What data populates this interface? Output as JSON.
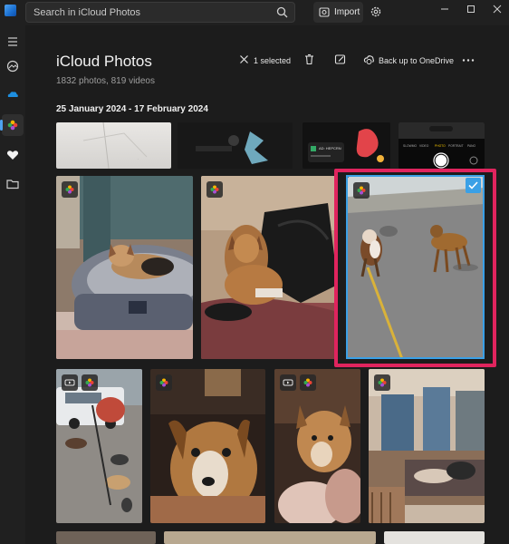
{
  "titlebar": {
    "search_placeholder": "Search in iCloud Photos",
    "import_label": "Import",
    "icons": [
      "app-logo-icon",
      "search-icon",
      "import-icon",
      "gear-icon",
      "minimize-icon",
      "maximize-icon",
      "close-icon"
    ]
  },
  "sidebar": {
    "items": [
      {
        "name": "menu",
        "icon": "hamburger-icon"
      },
      {
        "name": "gallery",
        "icon": "photos-icon"
      },
      {
        "name": "onedrive",
        "icon": "cloud-icon"
      },
      {
        "name": "icloud-photos",
        "icon": "icloud-photos-icon",
        "selected": true
      },
      {
        "name": "favorites",
        "icon": "heart-icon"
      },
      {
        "name": "folders",
        "icon": "folder-icon"
      }
    ]
  },
  "header": {
    "title": "iCloud Photos",
    "subtitle": "1832 photos, 819 videos"
  },
  "toolbar": {
    "selected_label": "1 selected",
    "backup_label": "Back up to OneDrive",
    "icons": [
      "close-icon",
      "trash-icon",
      "edit-icon",
      "cloud-upload-icon",
      "more-icon"
    ]
  },
  "section": {
    "date_range": "25 January 2024 - 17 February 2024"
  },
  "colors": {
    "accent": "#3aa0e6",
    "highlight": "#e0245e",
    "background": "#1c1c1c",
    "chrome": "#202020"
  },
  "photos": {
    "row0": [
      "paper-photo",
      "shirt-photo",
      "phone-screenshot",
      "camera-screenshot"
    ],
    "row1": [
      "dog-in-bed-photo",
      "dog-on-bag-photo",
      "two-dogs-street-photo"
    ],
    "row2": [
      "street-dogs-video",
      "dog-closeup-photo",
      "puppy-closeup-video",
      "dog-room-photo"
    ],
    "selected": "two-dogs-street-photo"
  },
  "screenshot_text": {
    "ad_label": "AD: HEPCRN",
    "camera_modes": [
      "SLOWMO",
      "VIDEO",
      "PHOTO",
      "PORTRAIT",
      "PANO"
    ]
  }
}
